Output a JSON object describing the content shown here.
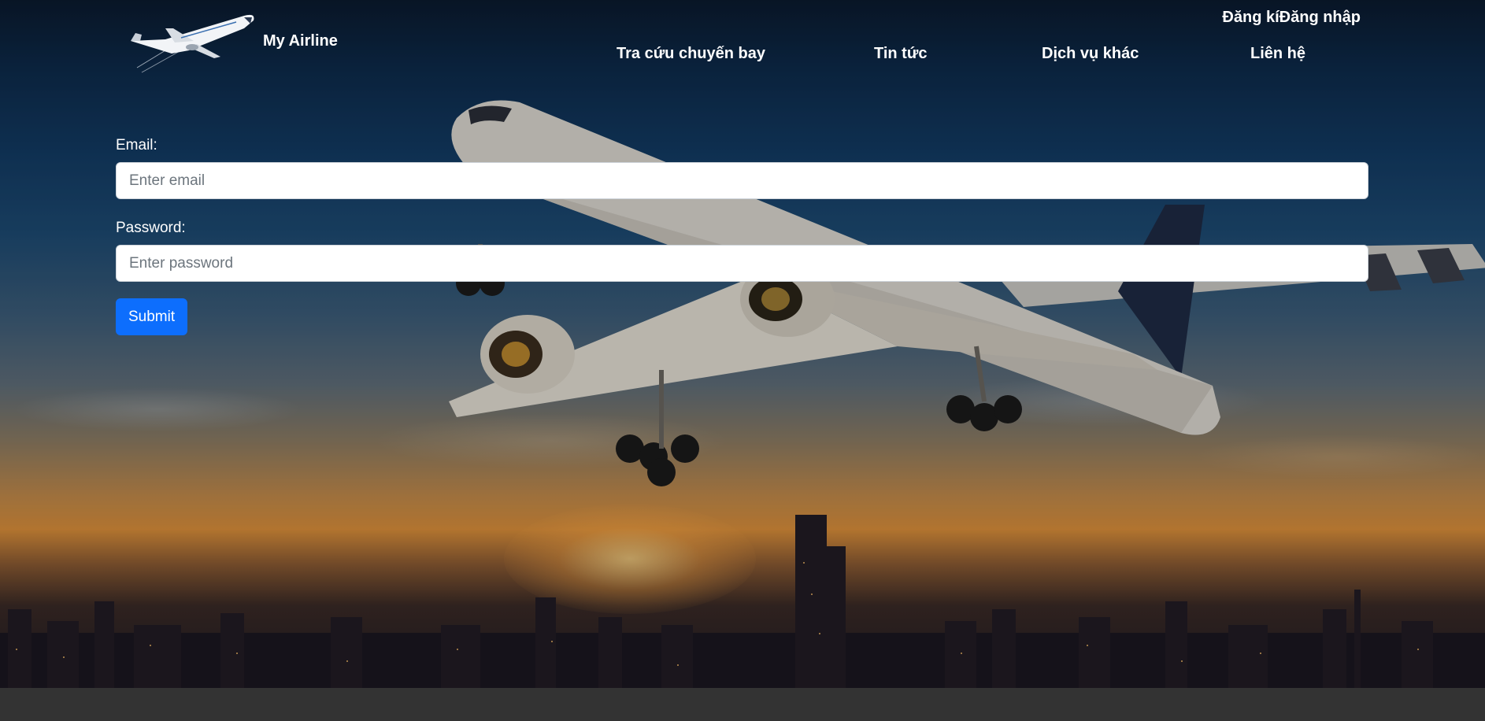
{
  "header": {
    "brand": "My Airline",
    "auth": {
      "register_label": "Đăng kí",
      "login_label": "Đăng nhập"
    },
    "nav": [
      {
        "label": "Tra cứu chuyến bay"
      },
      {
        "label": "Tin tức"
      },
      {
        "label": "Dịch vụ khác"
      },
      {
        "label": "Liên hệ"
      }
    ]
  },
  "form": {
    "email": {
      "label": "Email:",
      "placeholder": "Enter email",
      "value": ""
    },
    "password": {
      "label": "Password:",
      "placeholder": "Enter password",
      "value": ""
    },
    "submit_label": "Submit"
  },
  "icons": {
    "logo": "airplane-logo-icon",
    "hero": "airplane-background-image"
  },
  "colors": {
    "primary_button": "#0d6efd",
    "footer": "#333333",
    "text": "#ffffff"
  }
}
